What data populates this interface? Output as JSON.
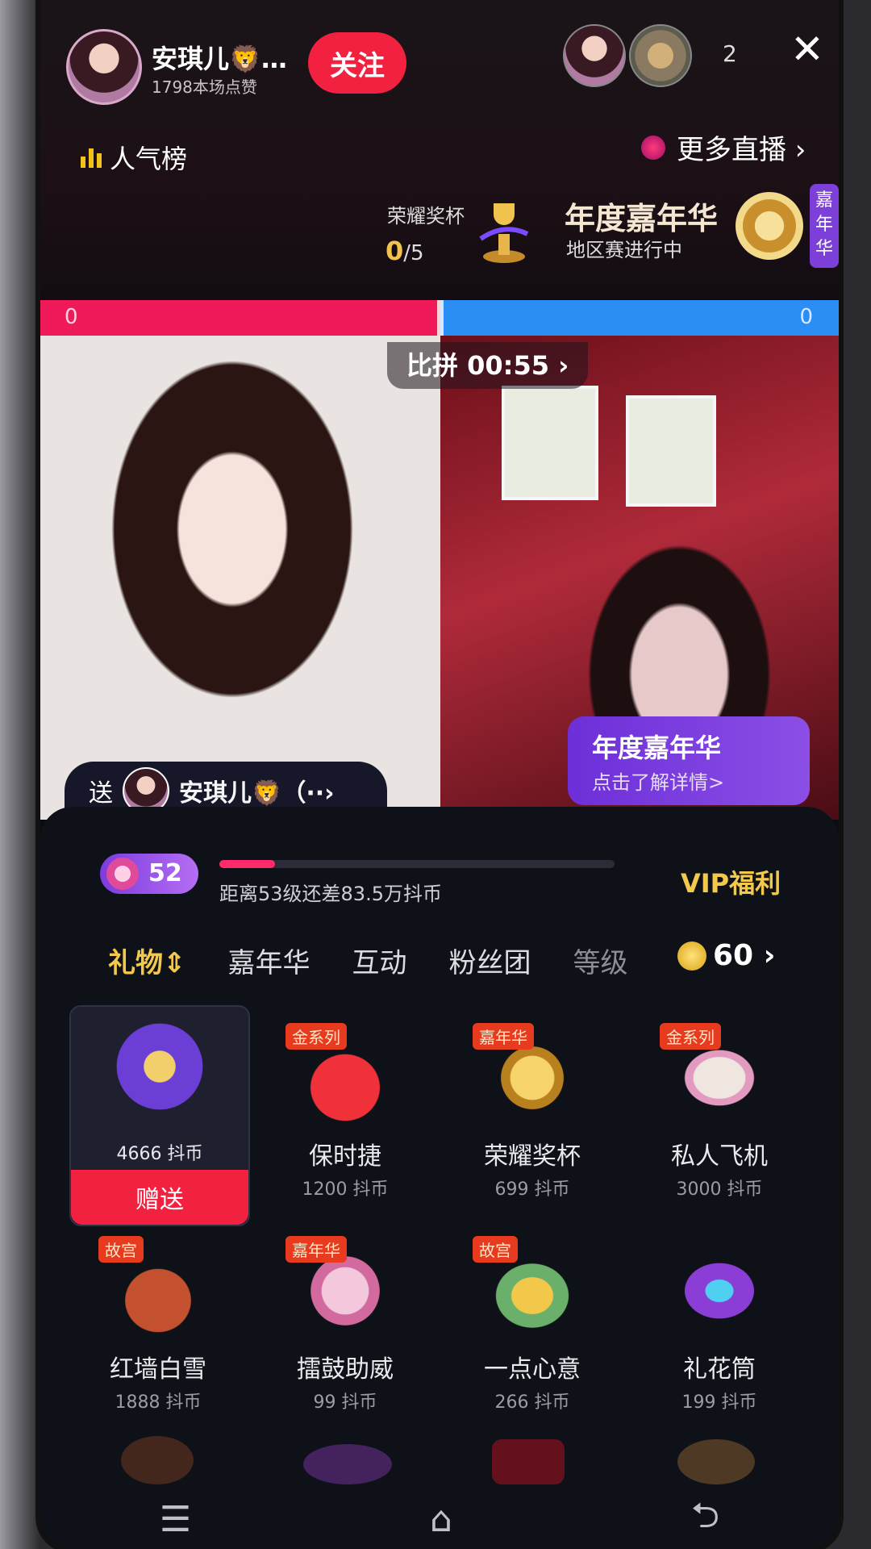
{
  "header": {
    "host_name": "安琪儿🦁…",
    "host_likes": "1798本场点赞",
    "follow_label": "关注",
    "viewer_count": "2",
    "close_label": "✕",
    "rank_label": "人气榜",
    "more_live_label": "更多直播 ›"
  },
  "event": {
    "trophy_label": "荣耀奖杯",
    "trophy_progress": "0",
    "trophy_total": "/5",
    "carnival_title": "年度嘉年华",
    "carnival_subtitle": "地区赛进行中",
    "carnival_tag": "嘉年华"
  },
  "pk": {
    "left_score": "0",
    "right_score": "0",
    "timer": "比拼 00:55 ›"
  },
  "banner": {
    "title": "年度嘉年华",
    "subtitle": "点击了解详情>"
  },
  "send_to": {
    "prefix": "送",
    "name": "安琪儿🦁（··›"
  },
  "level": {
    "badge": "52",
    "progress_fraction": 0.14,
    "text": "距离53级还差83.5万抖币",
    "vip_label": "VIP福利"
  },
  "tabs": [
    {
      "label": "礼物⇕"
    },
    {
      "label": "嘉年华"
    },
    {
      "label": "互动"
    },
    {
      "label": "粉丝团"
    },
    {
      "label": "等级"
    }
  ],
  "balance": "60 ›",
  "gifts": [
    {
      "name": "",
      "price": "4666 抖币",
      "tag": "",
      "send_label": "赠送",
      "color": "#6b3fd6"
    },
    {
      "name": "保时捷",
      "price": "1200 抖币",
      "tag": "金系列",
      "color": "#d91a24"
    },
    {
      "name": "荣耀奖杯",
      "price": "699 抖币",
      "tag": "嘉年华",
      "color": "#d8a22a"
    },
    {
      "name": "私人飞机",
      "price": "3000 抖币",
      "tag": "金系列",
      "color": "#e8d8d2"
    },
    {
      "name": "红墙白雪",
      "price": "1888 抖币",
      "tag": "故宫",
      "color": "#c3502e"
    },
    {
      "name": "擂鼓助威",
      "price": "99 抖币",
      "tag": "嘉年华",
      "color": "#e08ab6"
    },
    {
      "name": "一点心意",
      "price": "266 抖币",
      "tag": "故宫",
      "color": "#6bb06a"
    },
    {
      "name": "礼花筒",
      "price": "199 抖币",
      "tag": "",
      "color": "#8a3ed6"
    }
  ],
  "nav": {
    "menu": "☰",
    "home": "⌂",
    "back": "⮌"
  }
}
